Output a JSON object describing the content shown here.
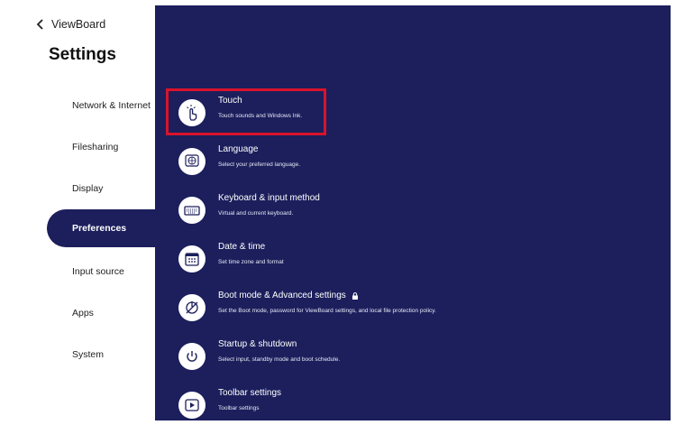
{
  "header": {
    "back_label": "ViewBoard",
    "title": "Settings"
  },
  "sidebar": {
    "items": [
      {
        "label": "Network & Internet"
      },
      {
        "label": "Filesharing"
      },
      {
        "label": "Display"
      },
      {
        "label": "Preferences",
        "active": true
      },
      {
        "label": "Input source"
      },
      {
        "label": "Apps"
      },
      {
        "label": "System"
      }
    ]
  },
  "preferences": {
    "items": [
      {
        "title": "Touch",
        "subtitle": "Touch sounds and Windows Ink.",
        "icon": "touch-hand-icon",
        "highlighted": true
      },
      {
        "title": "Language",
        "subtitle": "Select your preferred language.",
        "icon": "globe-icon"
      },
      {
        "title": "Keyboard & input method",
        "subtitle": "Virtual and current keyboard.",
        "icon": "keyboard-icon"
      },
      {
        "title": "Date & time",
        "subtitle": "Set time zone and format",
        "icon": "calendar-icon"
      },
      {
        "title": "Boot mode & Advanced settings",
        "subtitle": "Set the Boot mode, password for ViewBoard settings, and local file protection policy.",
        "icon": "boot-settings-icon",
        "locked": true
      },
      {
        "title": "Startup & shutdown",
        "subtitle": "Select input, standby mode and boot schedule.",
        "icon": "power-icon"
      },
      {
        "title": "Toolbar settings",
        "subtitle": "Toolbar settings",
        "icon": "toolbar-icon"
      }
    ]
  },
  "colors": {
    "panel": "#1c1f5c",
    "highlight": "#d8132b",
    "background": "#ffffff"
  }
}
